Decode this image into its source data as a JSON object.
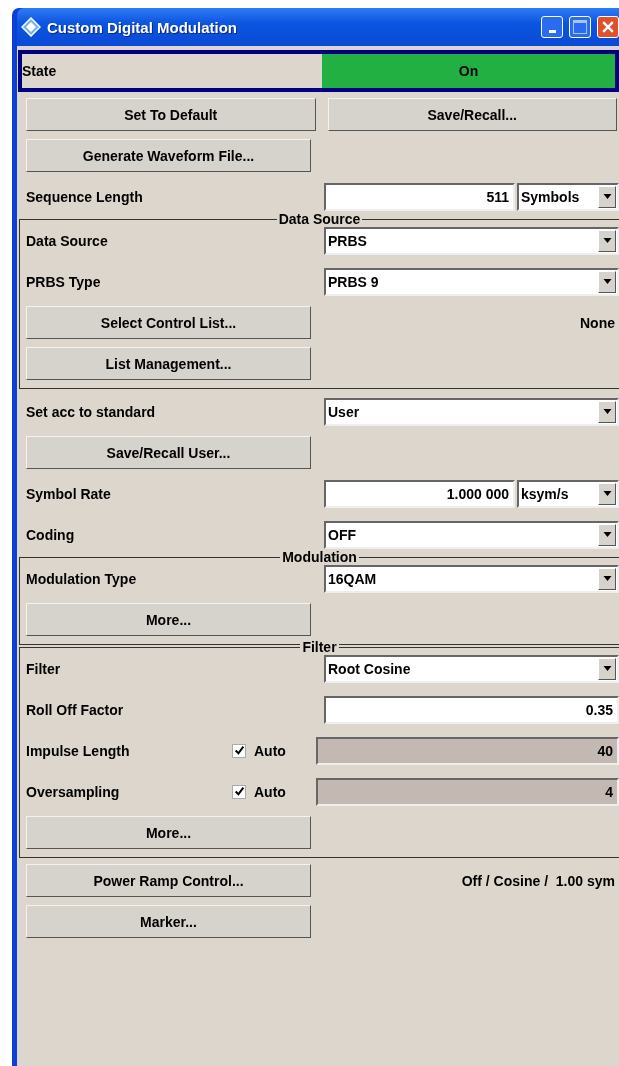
{
  "window": {
    "title": "Custom Digital Modulation"
  },
  "state": {
    "label": "State",
    "value": "On",
    "on": true
  },
  "items": [
    {
      "kind": "buttons",
      "buttons": [
        "Set To Default",
        "Save/Recall..."
      ]
    },
    {
      "kind": "button",
      "button": "Generate Waveform File..."
    },
    {
      "kind": "number",
      "label": "Sequence Length",
      "value": "511",
      "unit": "Symbols"
    },
    {
      "kind": "group",
      "title": "Data Source",
      "items": [
        {
          "kind": "select",
          "label": "Data Source",
          "value": "PRBS"
        },
        {
          "kind": "select",
          "label": "PRBS Type",
          "value": "PRBS 9"
        },
        {
          "kind": "button",
          "button": "Select Control List...",
          "status": "None"
        },
        {
          "kind": "button",
          "button": "List Management..."
        }
      ]
    },
    {
      "kind": "select",
      "label": "Set acc to standard",
      "value": "User"
    },
    {
      "kind": "button",
      "button": "Save/Recall User..."
    },
    {
      "kind": "number",
      "label": "Symbol Rate",
      "value": "1.000 000",
      "unit": "ksym/s"
    },
    {
      "kind": "select",
      "label": "Coding",
      "value": "OFF"
    },
    {
      "kind": "group",
      "title": "Modulation",
      "items": [
        {
          "kind": "select",
          "label": "Modulation Type",
          "value": "16QAM"
        },
        {
          "kind": "button",
          "button": "More..."
        }
      ]
    },
    {
      "kind": "group",
      "title": "Filter",
      "items": [
        {
          "kind": "select",
          "label": "Filter",
          "value": "Root Cosine"
        },
        {
          "kind": "number",
          "label": "Roll Off Factor",
          "value": "0.35"
        },
        {
          "kind": "auto",
          "label": "Impulse Length",
          "auto_label": "Auto",
          "checked": true,
          "value": "40"
        },
        {
          "kind": "auto",
          "label": "Oversampling",
          "auto_label": "Auto",
          "checked": true,
          "value": "4"
        },
        {
          "kind": "button",
          "button": "More..."
        }
      ]
    },
    {
      "kind": "button",
      "button": "Power Ramp Control...",
      "status": "Off / Cosine /  1.00 sym"
    },
    {
      "kind": "button",
      "button": "Marker..."
    }
  ]
}
